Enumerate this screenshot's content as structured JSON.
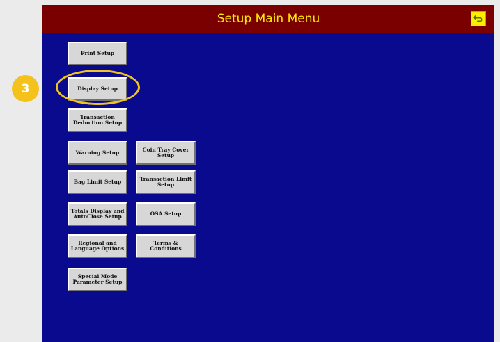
{
  "header": {
    "title": "Setup Main Menu",
    "back_icon": "return-arrow-icon"
  },
  "menu": {
    "print_setup": "Print Setup",
    "display_setup": "Display Setup",
    "transaction_deduction_setup": "Transaction\nDeduction Setup",
    "warning_setup": "Warning Setup",
    "coin_tray_cover_setup": "Coin Tray Cover\nSetup",
    "bag_limit_setup": "Bag Limit Setup",
    "transaction_limit_setup": "Transaction Limit\nSetup",
    "totals_display_autoclose_setup": "Totals Display and\nAutoClose Setup",
    "osa_setup": "OSA Setup",
    "regional_language_options": "Regional and\nLanguage Options",
    "terms_conditions": "Terms & Conditions",
    "special_mode_parameter_setup": "Special Mode\nParameter Setup"
  },
  "annotation": {
    "step_number": "3"
  },
  "colors": {
    "screen_background": "#0a0a8f",
    "title_bar": "#7a0000",
    "title_text": "#ffea00",
    "highlight": "#f0c419"
  }
}
